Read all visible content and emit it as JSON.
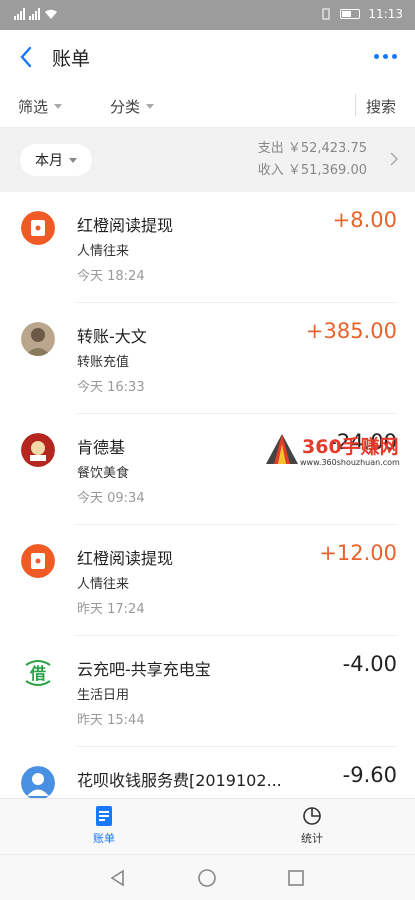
{
  "status_bar": {
    "time": "11:13"
  },
  "header": {
    "title": "账单"
  },
  "filters": {
    "filter_label": "筛选",
    "category_label": "分类",
    "search_label": "搜索"
  },
  "summary": {
    "period": "本月",
    "expense": "支出 ￥52,423.75",
    "income": "收入 ￥51,369.00"
  },
  "transactions": [
    {
      "name": "红橙阅读提现",
      "category": "人情往来",
      "time": "今天 18:24",
      "amount": "+8.00",
      "icon": "red-envelope-icon"
    },
    {
      "name": "转账-大文",
      "category": "转账充值",
      "time": "今天 16:33",
      "amount": "+385.00",
      "icon": "user-avatar-photo"
    },
    {
      "name": "肯德基",
      "category": "餐饮美食",
      "time": "今天 09:34",
      "amount": "-24.00",
      "icon": "kfc-logo-icon"
    },
    {
      "name": "红橙阅读提现",
      "category": "人情往来",
      "time": "昨天 17:24",
      "amount": "+12.00",
      "icon": "red-envelope-icon"
    },
    {
      "name": "云充吧-共享充电宝",
      "category": "生活日用",
      "time": "昨天 15:44",
      "amount": "-4.00",
      "icon": "borrow-icon",
      "icon_char": "借"
    },
    {
      "name": "花呗收钱服务费[2019102...",
      "category": "",
      "time": "",
      "amount": "-9.60",
      "icon": "person-avatar-icon"
    }
  ],
  "watermark": {
    "text": "360手赚网",
    "url": "www.360shouzhuan.com"
  },
  "tabs": [
    {
      "label": "账单",
      "icon": "bill-icon",
      "active": true
    },
    {
      "label": "统计",
      "icon": "chart-pie-icon",
      "active": false
    }
  ],
  "colors": {
    "accent": "#1677ff",
    "income": "#e8632b",
    "envelope": "#f05a24",
    "borrow": "#2ba246"
  }
}
